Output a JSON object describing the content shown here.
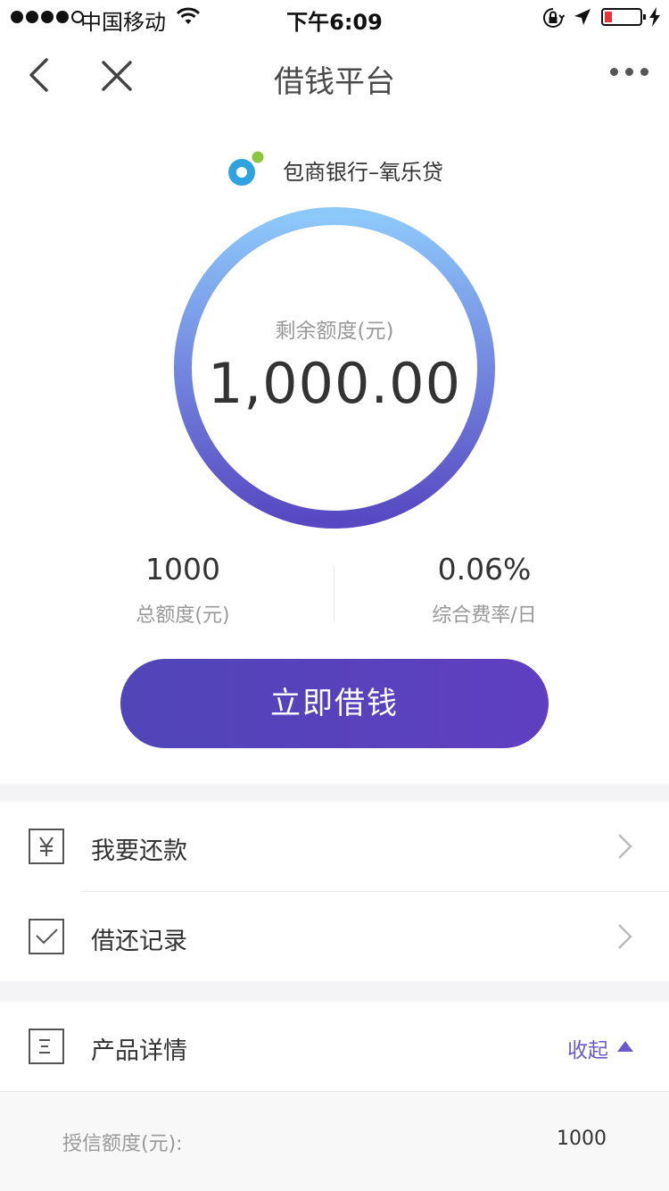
{
  "status_bar": {
    "carrier": "中国移动",
    "time": "下午6:09",
    "signal_bars_filled": 4,
    "signal_bars_total": 5,
    "battery_level": 0.2,
    "battery_color": "#e8343a"
  },
  "nav": {
    "title": "借钱平台",
    "back_icon": "chevron-left-icon",
    "close_icon": "close-icon",
    "more_icon": "more-dots-icon"
  },
  "bank": {
    "name": "包商银行–氧乐贷"
  },
  "credit": {
    "label": "剩余额度(元)",
    "amount": "1,000.00"
  },
  "stats": {
    "total_value": "1000",
    "total_caption": "总额度(元)",
    "rate_value": "0.06%",
    "rate_caption": "综合费率/日"
  },
  "borrow_button": {
    "label": "立即借钱"
  },
  "menu": {
    "repay_label": "我要还款",
    "records_label": "借还记录"
  },
  "product": {
    "label": "产品详情",
    "collapse_label": "收起"
  },
  "details": {
    "credit_line_key": "授信额度(元):",
    "credit_line_value": "1000"
  },
  "colors": {
    "accent": "#6a5acd",
    "button_start": "#5145b8",
    "button_end": "#5f3fc0",
    "ring_top": "#8dc8fb",
    "ring_bottom": "#5848c2"
  }
}
